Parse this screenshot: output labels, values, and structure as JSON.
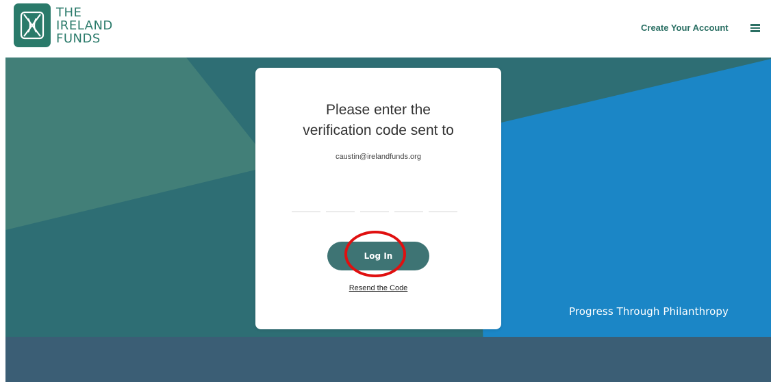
{
  "header": {
    "logo_lines": [
      "THE",
      "IRELAND",
      "FUNDS"
    ],
    "create_account_label": "Create Your Account",
    "menu_icon": "hamburger-menu-icon"
  },
  "login_card": {
    "title_line1": "Please enter the",
    "title_line2": "verification code sent to",
    "email": "caustin@irelandfunds.org",
    "code_inputs": [
      {
        "value": "",
        "placeholder": ""
      },
      {
        "value": "",
        "placeholder": ""
      },
      {
        "value": "",
        "placeholder": ""
      },
      {
        "value": "",
        "placeholder": ""
      },
      {
        "value": "",
        "placeholder": ""
      }
    ],
    "login_label": "Log In",
    "resend_label": "Resend the Code"
  },
  "footer": {
    "tagline": "Progress Through Philanthropy"
  },
  "colors": {
    "brand_green": "#2a7a6a",
    "button_teal": "#3e7474",
    "hero_blue": "#1b86c6",
    "footer_slate": "#3b5e75",
    "annotation_red": "#e01010"
  }
}
